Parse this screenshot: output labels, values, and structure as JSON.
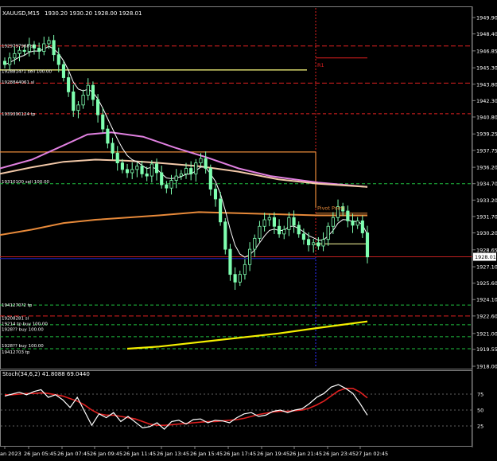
{
  "header": {
    "symbol": "XAUUSD,M15",
    "ohlc": "1930.20 1930.20 1928.00 1928.01"
  },
  "price_axis": {
    "labels": [
      "1949.90",
      "1948.40",
      "1946.85",
      "1945.30",
      "1943.80",
      "1942.30",
      "1940.80",
      "1939.25",
      "1937.75",
      "1936.20",
      "1934.70",
      "1933.20",
      "1931.70",
      "1930.20",
      "1928.65",
      "1927.10",
      "1925.60",
      "1924.10",
      "1922.60",
      "1921.00",
      "1919.55",
      "1918.00"
    ],
    "current_price": "1928.01",
    "range": [
      1918.0,
      1949.9
    ]
  },
  "time_axis": {
    "labels": [
      "an 2023",
      "26 Jan 05:45",
      "26 Jan 07:45",
      "26 Jan 09:45",
      "26 Jan 11:45",
      "26 Jan 13:45",
      "26 Jan 15:45",
      "26 Jan 17:45",
      "26 Jan 19:45",
      "26 Jan 21:45",
      "26 Jan 23:45",
      "27 Jan 02:45"
    ]
  },
  "chart_labels": {
    "order_1": "1929797968 sl",
    "order_2": "1928814?1 sell 100.00",
    "order_3": "1928844061 sl",
    "order_4": "1939390124 tp",
    "order_5": "19310100 sell 100.00",
    "order_6": "1941270?2 tp",
    "order_7": "19208281 sl",
    "order_8": "19214 tp buy 100.00",
    "order_9": "1928?? buy 100.00",
    "order_10": "1928?? buy 100.00",
    "order_11": "19412703 tp",
    "r1": "R1",
    "pivot": "Pivot Point"
  },
  "stochastic": {
    "label": "Stoch(34,6,2) 41.8088 69.0440",
    "levels": [
      "75",
      "50",
      "25"
    ],
    "scale_top": "100",
    "scale_bottom": "0"
  },
  "colors": {
    "background": "#000000",
    "candle": "#7fffb0",
    "ma_pink": "#e080e0",
    "ma_peach": "#f2c8a8",
    "ma_orange": "#e88a3a",
    "ma_yellow": "#f5f000",
    "ma_white": "#ffffff",
    "level_red": "#e02020",
    "level_green": "#20c040",
    "stoch_main": "#ffffff",
    "stoch_signal": "#e02020"
  },
  "chart_data": {
    "type": "candlestick",
    "symbol": "XAUUSD,M15",
    "ylim": [
      1918.0,
      1949.9
    ],
    "y_ticks": [
      1949.9,
      1948.4,
      1946.85,
      1945.3,
      1943.8,
      1942.3,
      1940.8,
      1939.25,
      1937.75,
      1936.2,
      1934.7,
      1933.2,
      1931.7,
      1930.2,
      1928.65,
      1927.1,
      1925.6,
      1924.1,
      1922.6,
      1921.0,
      1919.55,
      1918.0
    ],
    "x_ticks": [
      "an 2023",
      "26 Jan 05:45",
      "26 Jan 07:45",
      "26 Jan 09:45",
      "26 Jan 11:45",
      "26 Jan 13:45",
      "26 Jan 15:45",
      "26 Jan 17:45",
      "26 Jan 19:45",
      "26 Jan 21:45",
      "26 Jan 23:45",
      "27 Jan 02:45"
    ],
    "close_series": [
      1945.6,
      1946.2,
      1946.6,
      1946.9,
      1946.8,
      1947.4,
      1947.1,
      1946.8,
      1947.5,
      1947.8,
      1946.5,
      1945.6,
      1944.4,
      1943.1,
      1941.4,
      1941.9,
      1942.8,
      1943.7,
      1942.4,
      1941.0,
      1939.7,
      1938.4,
      1937.5,
      1936.6,
      1936.0,
      1935.7,
      1936.0,
      1936.3,
      1935.6,
      1935.4,
      1936.5,
      1935.7,
      1934.6,
      1934.3,
      1935.0,
      1935.4,
      1935.6,
      1936.1,
      1935.6,
      1936.6,
      1937.0,
      1936.1,
      1934.2,
      1933.3,
      1931.2,
      1928.7,
      1926.4,
      1925.7,
      1926.4,
      1927.3,
      1928.7,
      1929.7,
      1930.8,
      1931.4,
      1931.6,
      1930.8,
      1930.1,
      1930.5,
      1931.6,
      1930.9,
      1930.1,
      1929.6,
      1929.1,
      1929.3,
      1929.0,
      1929.6,
      1930.8,
      1931.6,
      1932.6,
      1932.2,
      1931.3,
      1930.9,
      1931.3,
      1930.2,
      1928.0
    ],
    "moving_averages": [
      {
        "values_start": 1936.1,
        "values_mid": 1939.3,
        "values_end": 1934.3
      },
      {
        "values_start": 1935.6,
        "values_mid": 1936.8,
        "values_end": 1934.3
      },
      {
        "values_start": 1930.0,
        "values_mid": 1932.0,
        "values_end": 1931.8
      },
      {
        "values_start": 1917.5,
        "values_mid": 1919.8,
        "values_end": 1922.1
      }
    ],
    "levels": [
      {
        "type": "sl",
        "price": 1947.3
      },
      {
        "type": "r1",
        "price": 1945.1
      },
      {
        "type": "sl",
        "price": 1943.9
      },
      {
        "type": "tp",
        "price": 1941.1
      },
      {
        "type": "entry",
        "price": 1934.7
      },
      {
        "type": "pivot",
        "price": 1932.0
      },
      {
        "type": "current",
        "price": 1928.01
      },
      {
        "type": "tp",
        "price": 1923.6
      },
      {
        "type": "sl",
        "price": 1922.6
      },
      {
        "type": "entry",
        "price": 1921.8
      },
      {
        "type": "entry",
        "price": 1920.7
      },
      {
        "type": "tp",
        "price": 1919.6
      }
    ],
    "stochastic": {
      "k": 41.8088,
      "d": 69.044,
      "levels": [
        75,
        50,
        25
      ]
    }
  }
}
